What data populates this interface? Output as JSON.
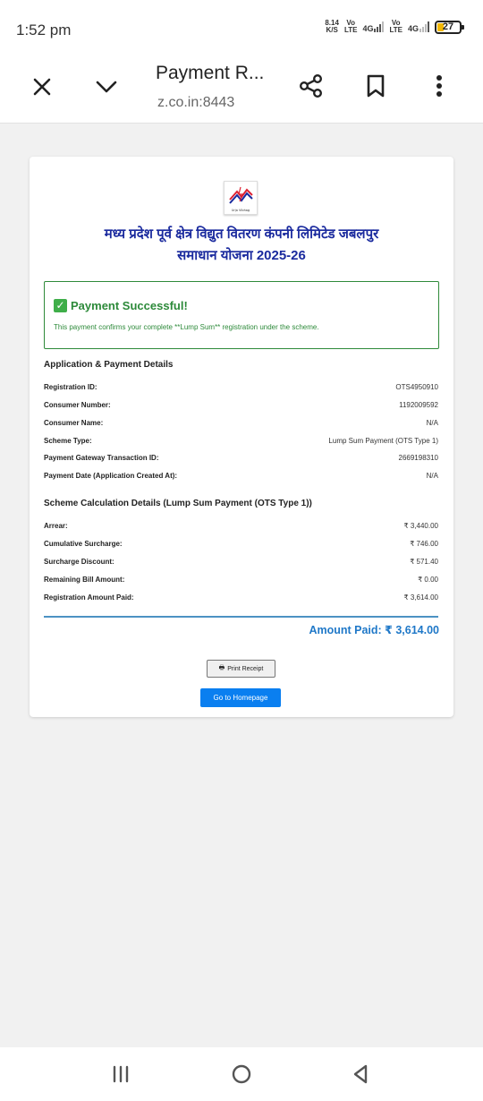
{
  "status_bar": {
    "time": "1:52 pm",
    "speed_value": "8.14",
    "speed_unit": "K/S",
    "sim1_top": "Vo",
    "sim1_bottom": "LTE",
    "sim1_net": "4G",
    "sim2_top": "Vo",
    "sim2_bottom": "LTE",
    "sim2_net": "4G",
    "battery": "27"
  },
  "browser": {
    "title": "Payment R...",
    "url": "z.co.in:8443",
    "close_icon": "close-icon",
    "expand_icon": "chevron-down-icon",
    "share_icon": "share-icon",
    "bookmark_icon": "bookmark-icon",
    "menu_icon": "more-vert-icon"
  },
  "page": {
    "logo_caption": "Urja Vibhag",
    "org_name": "मध्य प्रदेश पूर्व क्षेत्र विद्युत वितरण कंपनी लिमिटेड जबलपुर",
    "scheme_name": "समाधान योजना 2025-26",
    "success_title": "Payment Successful!",
    "success_message": "This payment confirms your complete **Lump Sum** registration under the scheme.",
    "details_title": "Application & Payment Details",
    "details": [
      {
        "label": "Registration ID:",
        "value": "OTS4950910"
      },
      {
        "label": "Consumer Number:",
        "value": "1192009592"
      },
      {
        "label": "Consumer Name:",
        "value": "N/A"
      },
      {
        "label": "Scheme Type:",
        "value": "Lump Sum Payment (OTS Type 1)"
      },
      {
        "label": "Payment Gateway Transaction ID:",
        "value": "2669198310"
      },
      {
        "label": "Payment Date (Application Created At):",
        "value": "N/A"
      }
    ],
    "calc_title": "Scheme Calculation Details (Lump Sum Payment (OTS Type 1))",
    "calc": [
      {
        "label": "Arrear:",
        "value": "₹ 3,440.00"
      },
      {
        "label": "Cumulative Surcharge:",
        "value": "₹ 746.00"
      },
      {
        "label": "Surcharge Discount:",
        "value": "₹ 571.40"
      },
      {
        "label": "Remaining Bill Amount:",
        "value": "₹ 0.00"
      },
      {
        "label": "Registration Amount Paid:",
        "value": "₹ 3,614.00"
      }
    ],
    "amount_paid": "Amount Paid: ₹ 3,614.00",
    "print_button": "Print Receipt",
    "home_button": "Go to Homepage"
  },
  "colors": {
    "org_blue": "#1a2a9e",
    "success_green": "#2d8a3a",
    "amount_blue": "#1f78c8",
    "button_blue": "#0a7ff0"
  }
}
